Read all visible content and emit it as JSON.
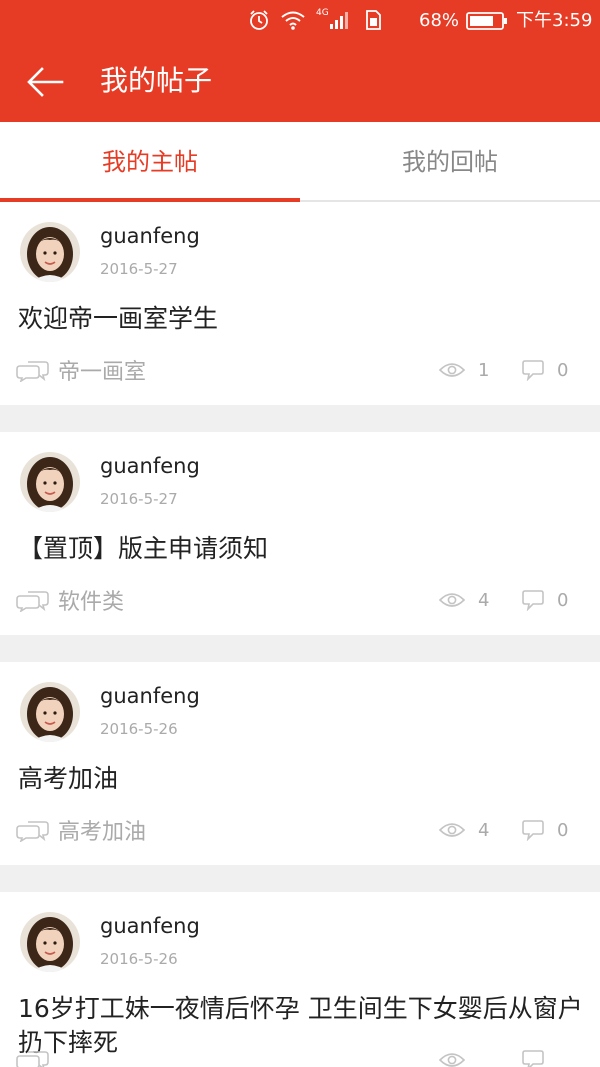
{
  "status_bar": {
    "battery_percent": "68%",
    "time": "下午3:59",
    "network": "4G",
    "icons": [
      "alarm-icon",
      "wifi-icon",
      "signal-icon",
      "sim-icon",
      "battery-icon"
    ]
  },
  "header": {
    "title": "我的帖子",
    "back_icon": "arrow-left-icon"
  },
  "tabs": [
    {
      "label": "我的主帖",
      "active": true
    },
    {
      "label": "我的回帖",
      "active": false
    }
  ],
  "posts": [
    {
      "username": "guanfeng",
      "date": "2016-5-27",
      "title": "欢迎帝一画室学生",
      "forum": "帝一画室",
      "views": "1",
      "comments": "0"
    },
    {
      "username": "guanfeng",
      "date": "2016-5-27",
      "title": "【置顶】版主申请须知",
      "forum": "软件类",
      "views": "4",
      "comments": "0"
    },
    {
      "username": "guanfeng",
      "date": "2016-5-26",
      "title": "高考加油",
      "forum": "高考加油",
      "views": "4",
      "comments": "0"
    },
    {
      "username": "guanfeng",
      "date": "2016-5-26",
      "title": "16岁打工妹一夜情后怀孕 卫生间生下女婴后从窗户扔下摔死",
      "forum": "",
      "views": "",
      "comments": ""
    }
  ],
  "colors": {
    "brand": "#e63c25",
    "muted": "#aaaaaa",
    "separator": "#f0f0f0"
  }
}
